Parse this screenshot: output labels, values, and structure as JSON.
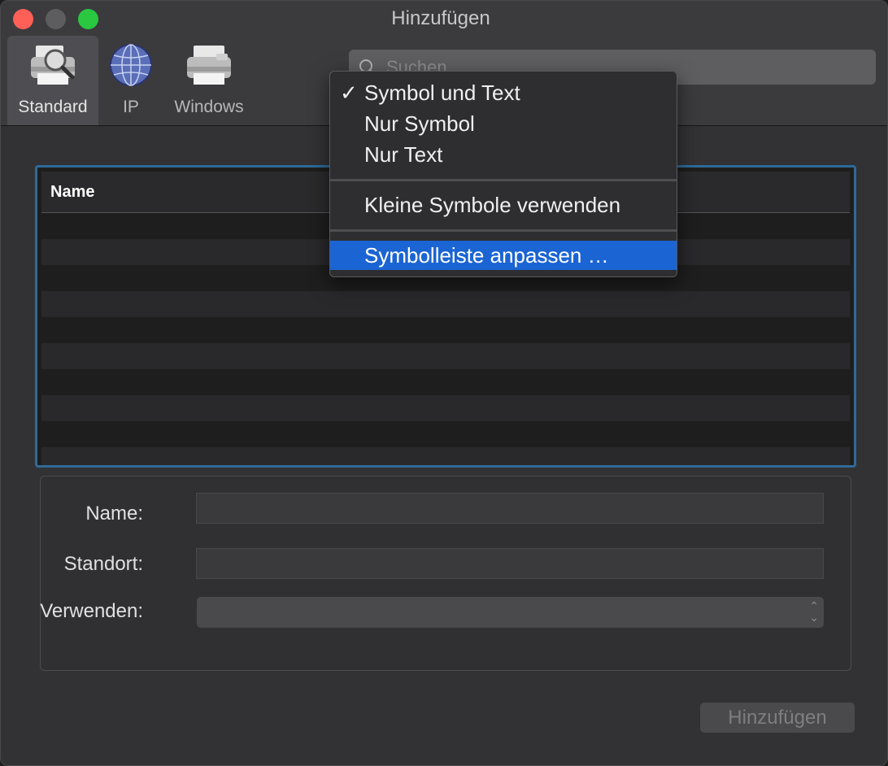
{
  "window": {
    "title": "Hinzufügen"
  },
  "toolbar": {
    "items": [
      {
        "label": "Standard",
        "icon": "printer-search-icon",
        "active": true
      },
      {
        "label": "IP",
        "icon": "globe-icon",
        "active": false
      },
      {
        "label": "Windows",
        "icon": "printer-icon",
        "active": false
      }
    ]
  },
  "search": {
    "placeholder": "Suchen",
    "value": ""
  },
  "table": {
    "columns": [
      "Name"
    ],
    "rows": []
  },
  "form": {
    "name_label": "Name:",
    "location_label": "Standort:",
    "use_label": "Verwenden:",
    "name_value": "",
    "location_value": "",
    "use_value": ""
  },
  "buttons": {
    "add_label": "Hinzufügen"
  },
  "context_menu": {
    "items": [
      {
        "label": "Symbol und Text",
        "checked": true,
        "check_mark": "✓"
      },
      {
        "label": "Nur Symbol",
        "checked": false
      },
      {
        "label": "Nur Text",
        "checked": false
      },
      {
        "label": "Kleine Symbole verwenden",
        "checked": false
      },
      {
        "label": "Symbolleiste anpassen …",
        "checked": false,
        "highlighted": true
      }
    ]
  },
  "colors": {
    "accent": "#1b64d3",
    "focus_ring": "#2f6a98",
    "close": "#fe5f57",
    "maximize": "#29c840"
  }
}
